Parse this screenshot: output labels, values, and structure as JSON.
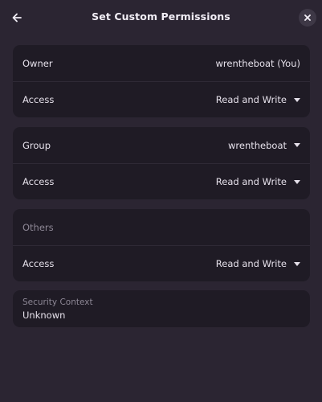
{
  "header": {
    "title": "Set Custom Permissions",
    "back_icon": "arrow-left-icon",
    "close_icon": "close-icon"
  },
  "owner_card": {
    "owner_label": "Owner",
    "owner_value": "wrentheboat (You)",
    "access_label": "Access",
    "access_value": "Read and Write"
  },
  "group_card": {
    "group_label": "Group",
    "group_value": "wrentheboat",
    "access_label": "Access",
    "access_value": "Read and Write"
  },
  "others_card": {
    "others_label": "Others",
    "access_label": "Access",
    "access_value": "Read and Write"
  },
  "security_context": {
    "title": "Security Context",
    "value": "Unknown"
  }
}
